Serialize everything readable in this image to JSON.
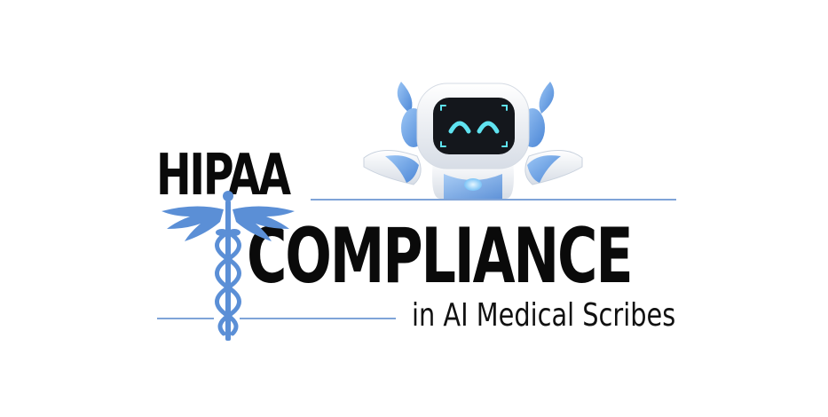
{
  "logo": {
    "line1": "HIPAA",
    "line2": "COMPLIANCE",
    "line3": "in AI Medical Scribes"
  },
  "colors": {
    "text": "#0a0a0a",
    "accent_blue": "#5b8fd6",
    "rule_blue": "#7fa4d8",
    "robot_white": "#f2f4f7",
    "robot_blue": "#6ea5e8",
    "screen": "#14171c",
    "eyes": "#5fe3f0"
  },
  "icons": {
    "emblem": "caduceus-icon",
    "mascot": "robot-icon"
  }
}
